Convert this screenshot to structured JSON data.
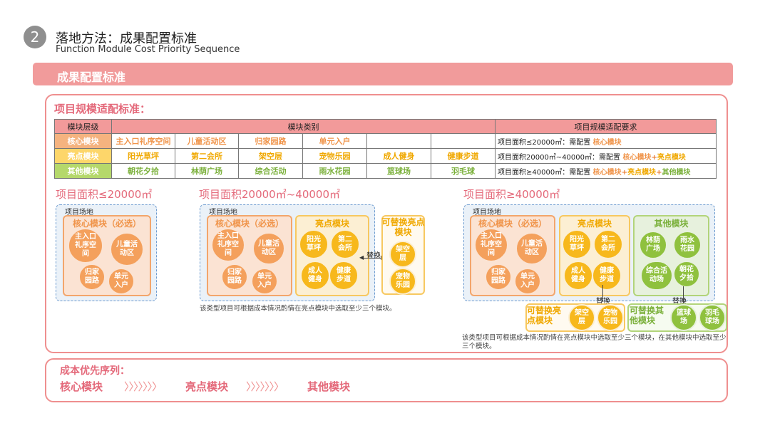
{
  "header": {
    "number": "2",
    "title_cn": "落地方法：成果配置标准",
    "title_en": "Function Module Cost Priority Sequence"
  },
  "banner": "成果配置标准",
  "section_title": "项目规模适配标准：",
  "table": {
    "headers": [
      "模块层级",
      "模块类别",
      "项目规模适配要求"
    ],
    "rows": [
      {
        "level": "核心模块",
        "items": [
          "主入口礼序空间",
          "儿童活动区",
          "归家园路",
          "单元入户",
          "",
          ""
        ],
        "req_prefix": "项目面积≤20000㎡：需配置",
        "req_parts": [
          {
            "text": " 核心模块",
            "cls": "k-core"
          }
        ]
      },
      {
        "level": "亮点模块",
        "items": [
          "阳光草坪",
          "第二会所",
          "架空层",
          "宠物乐园",
          "成人健身",
          "健康步道"
        ],
        "req_prefix": "项目面积20000㎡~40000㎡：需配置",
        "req_parts": [
          {
            "text": " 核心模块",
            "cls": "k-core"
          },
          {
            "text": "+",
            "cls": "k-plus"
          },
          {
            "text": "亮点模块",
            "cls": "k-hl"
          }
        ]
      },
      {
        "level": "其他模块",
        "items": [
          "朝花夕拾",
          "林荫广场",
          "综合活动",
          "雨水花园",
          "篮球场",
          "羽毛球"
        ],
        "req_prefix": "项目面积≥40000㎡：需配置",
        "req_parts": [
          {
            "text": " 核心模块",
            "cls": "k-core"
          },
          {
            "text": "+",
            "cls": "k-plus"
          },
          {
            "text": "亮点模块",
            "cls": "k-hl"
          },
          {
            "text": "+",
            "cls": "k-plus"
          },
          {
            "text": "其他模块",
            "cls": "k-other"
          }
        ]
      }
    ]
  },
  "areas": {
    "a1": "项目面积≤20000㎡",
    "a2": "项目面积20000㎡~40000㎡",
    "a3": "项目面积≥40000㎡"
  },
  "site_label": "项目场地",
  "groups": {
    "core": "核心模块（必选）",
    "highlight": "亮点模块",
    "other": "其他模块",
    "alt_highlight": "可替换亮点模块",
    "alt_other": "可替换其他模块"
  },
  "modules": {
    "entrance": "主入口\n礼序空\n间",
    "kids": "儿童活\n动区",
    "home_path": "归家\n园路",
    "unit": "单元\n入户",
    "lawn": "阳光\n草坪",
    "club": "第二\n会所",
    "fitness": "成人\n健身",
    "walk": "健康\n步道",
    "stilt": "架空\n层",
    "pet": "宠物\n乐园",
    "shade": "林荫\n广场",
    "rain": "雨水\n花园",
    "activity": "综合活\n动场",
    "flower": "朝花\n夕拾",
    "basket": "篮球\n场",
    "badminton": "羽毛\n球场"
  },
  "swap_label": "替换",
  "notes": {
    "n2": "该类型项目可根据成本情况酌情在亮点模块中选取至少三个模块。",
    "n3": "该类型项目可根据成本情况酌情在亮点模块中选取至少三个模块，在其他模块中选取至少三个模块。"
  },
  "sequence": {
    "title": "成本优先序列：",
    "steps": [
      "核心模块",
      "亮点模块",
      "其他模块"
    ],
    "arrow": "〉〉〉〉〉〉〉"
  },
  "colors": {
    "accent_pink": "#ef8f8f",
    "title_pink": "#e4697a",
    "core_orange": "#f4a05c",
    "highlight_yellow": "#f7b81c",
    "other_green": "#8fc13e"
  }
}
